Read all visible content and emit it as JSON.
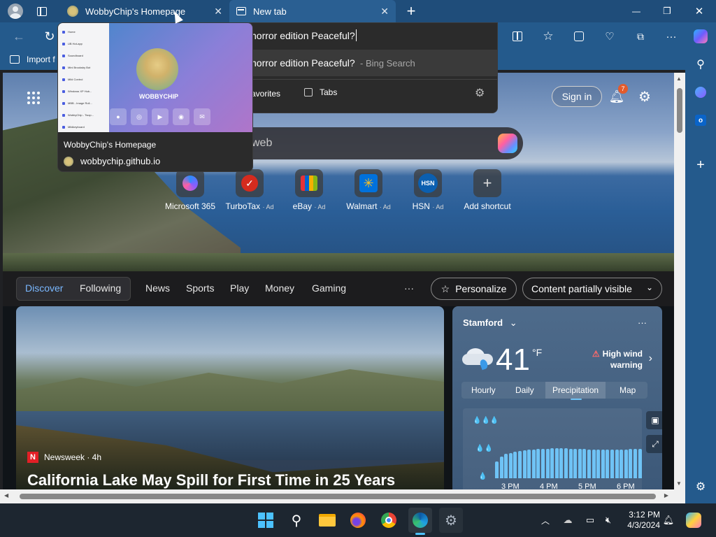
{
  "tabs": [
    {
      "title": "WobbyChip's Homepage",
      "close": "✕"
    },
    {
      "title": "New tab",
      "close": "✕"
    }
  ],
  "new_tab_symbol": "+",
  "window_controls": {
    "minimize": "—",
    "restore": "❐",
    "close": "✕"
  },
  "favbar": {
    "import_label": "Import f"
  },
  "address": {
    "query": "horror edition Peaceful?"
  },
  "suggestion": {
    "text": "horror edition Peaceful?",
    "source": "- Bing Search",
    "favorites_label": "avorites",
    "tabs_label": "Tabs"
  },
  "hovercard": {
    "title": "WobbyChip's Homepage",
    "url": "wobbychip.github.io",
    "site_name": "WOBBYCHIP",
    "menu": [
      "Home",
      "UB Hot-app",
      "Soundboard",
      "Mini Brooksby Bot",
      "Mild Control",
      "Windows XP Hub...",
      "MBB - Image Roll...",
      "WobbyChip - Twop...",
      "Mildkeyboard"
    ]
  },
  "search": {
    "placeholder": "web"
  },
  "header": {
    "sign_in": "Sign in",
    "notif_count": "7"
  },
  "shortcuts": [
    {
      "label": "Microsoft 365",
      "ad": ""
    },
    {
      "label": "TurboTax",
      "ad": "· Ad"
    },
    {
      "label": "eBay",
      "ad": "· Ad"
    },
    {
      "label": "Walmart",
      "ad": "· Ad"
    },
    {
      "label": "HSN",
      "ad": "· Ad",
      "icon_text": "HSN"
    },
    {
      "label": "Add shortcut",
      "ad": ""
    }
  ],
  "feed": {
    "tabs": [
      "Discover",
      "Following",
      "News",
      "Sports",
      "Play",
      "Money",
      "Gaming"
    ],
    "more": "···",
    "personalize": "Personalize",
    "content_visibility": "Content partially visible"
  },
  "news": {
    "source": "Newsweek · 4h",
    "headline": "California Lake May Spill for First Time in 25 Years"
  },
  "weather": {
    "location": "Stamford",
    "temp": "41",
    "unit": "°F",
    "alert_line1": "High wind",
    "alert_line2": "warning",
    "tabs": [
      "Hourly",
      "Daily",
      "Precipitation",
      "Map"
    ],
    "times": [
      "3 PM",
      "4 PM",
      "5 PM",
      "6 PM"
    ],
    "more": "···",
    "precip": [
      0.35,
      0.45,
      0.5,
      0.52,
      0.55,
      0.56,
      0.57,
      0.58,
      0.58,
      0.6,
      0.6,
      0.6,
      0.62,
      0.62,
      0.62,
      0.62,
      0.6,
      0.6,
      0.6,
      0.6,
      0.58,
      0.58,
      0.58,
      0.58,
      0.58,
      0.58,
      0.58,
      0.58,
      0.58,
      0.6,
      0.6,
      0.6
    ]
  },
  "taskbar": {
    "time": "3:12 PM",
    "date": "4/3/2024"
  },
  "colors": {
    "accent": "#2a5f92",
    "weather_bar": "#6fc3f5"
  }
}
